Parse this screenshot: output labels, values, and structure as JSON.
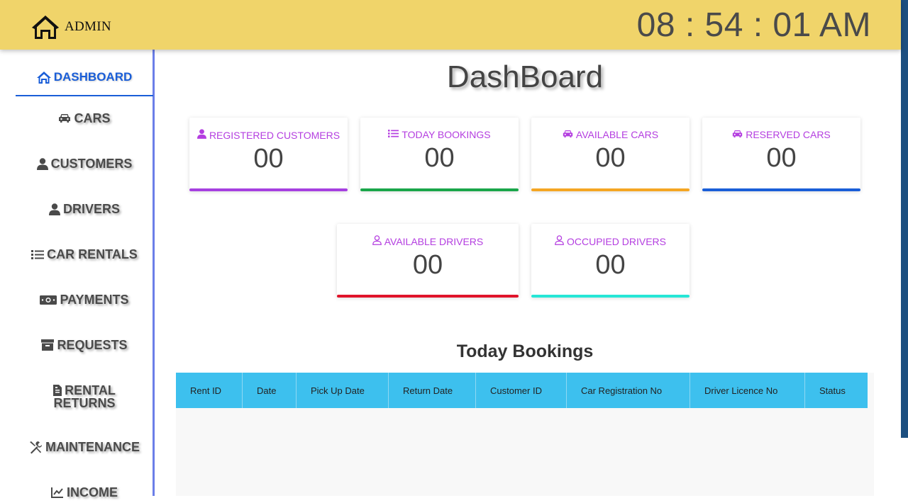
{
  "header": {
    "brand_label": "ADMIN",
    "clock": "08 : 54 : 01 AM"
  },
  "sidebar": {
    "items": [
      {
        "label": "DASHBOARD",
        "icon": "home-icon",
        "active": true
      },
      {
        "label": "CARS",
        "icon": "car-icon"
      },
      {
        "label": "CUSTOMERS",
        "icon": "user-icon"
      },
      {
        "label": "DRIVERS",
        "icon": "user-icon"
      },
      {
        "label": "CAR RENTALS",
        "icon": "list-icon"
      },
      {
        "label": "PAYMENTS",
        "icon": "money-icon"
      },
      {
        "label": "REQUESTS",
        "icon": "archive-icon"
      },
      {
        "label_line1": "RENTAL",
        "label_line2": "RETURNS",
        "icon": "file-icon"
      },
      {
        "label": "MAINTENANCE",
        "icon": "tools-icon"
      },
      {
        "label": "INCOME",
        "icon": "chart-line-icon"
      }
    ]
  },
  "main": {
    "title": "DashBoard",
    "cards": [
      {
        "label": "REGISTERED CUSTOMERS",
        "value": "00",
        "icon": "user-icon",
        "color": "#a640e0"
      },
      {
        "label": "TODAY BOOKINGS",
        "value": "00",
        "icon": "list-icon",
        "color": "#1aa64a"
      },
      {
        "label": "AVAILABLE CARS",
        "value": "00",
        "icon": "car-icon",
        "color": "#f5a623"
      },
      {
        "label": "RESERVED CARS",
        "value": "00",
        "icon": "car-icon",
        "color": "#1a5ed8"
      },
      {
        "label": "AVAILABLE DRIVERS",
        "value": "00",
        "icon": "user-outline-icon",
        "color": "#e0142a"
      },
      {
        "label": "OCCUPIED DRIVERS",
        "value": "00",
        "icon": "user-outline-icon",
        "color": "#26e6d6"
      }
    ],
    "bookings_title": "Today Bookings",
    "table": {
      "columns": [
        "Rent ID",
        "Date",
        "Pick Up Date",
        "Return Date",
        "Customer ID",
        "Car Registration No",
        "Driver Licence No",
        "Status"
      ],
      "rows": []
    }
  },
  "colors": {
    "header_bg": "#f0d46a",
    "accent": "#1a5ed8",
    "label_purple": "#b43ee0",
    "table_header": "#3dc0ee"
  }
}
